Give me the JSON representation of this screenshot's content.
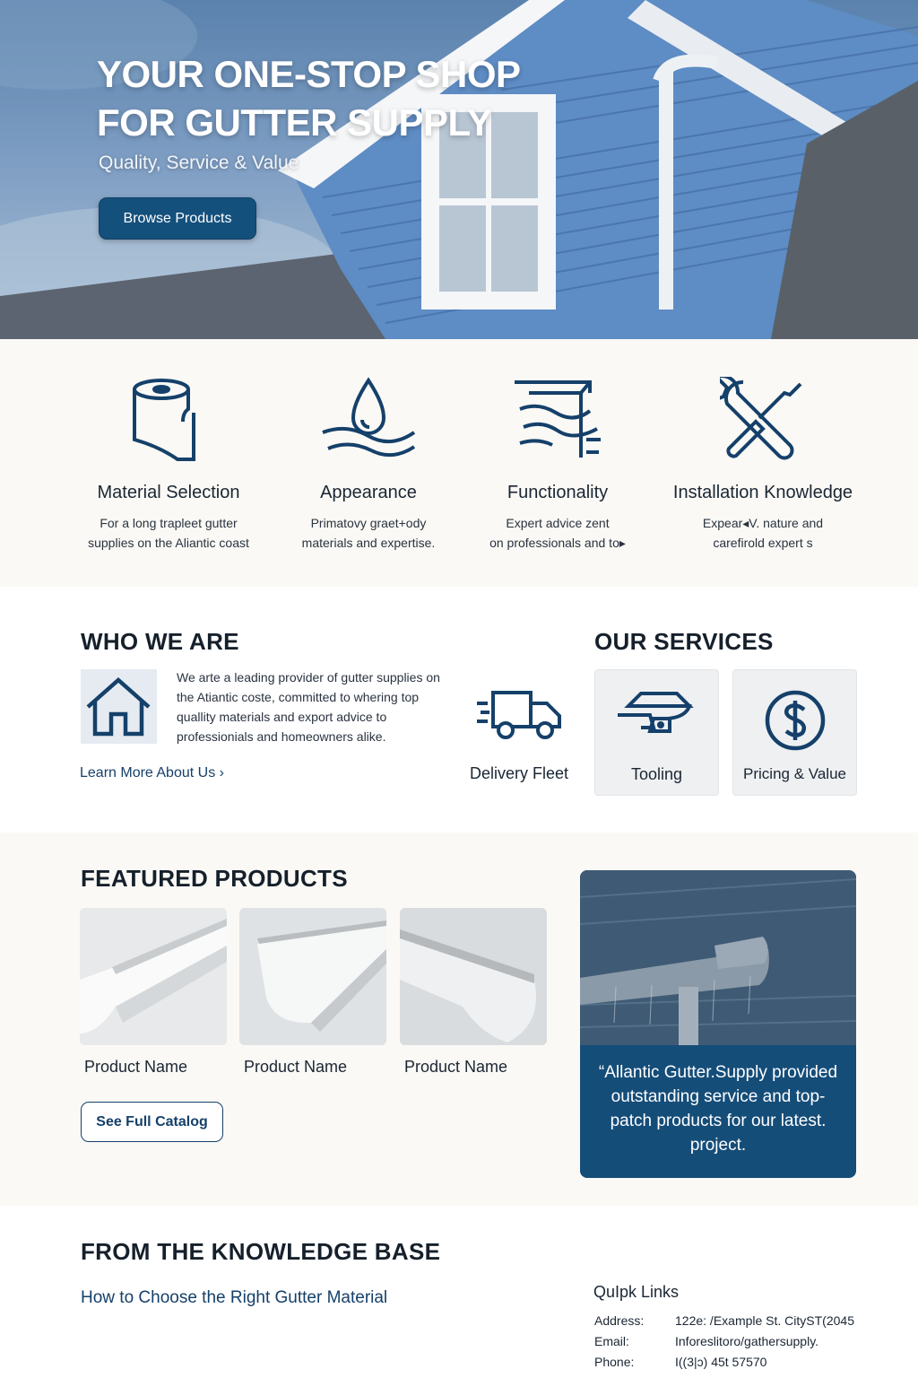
{
  "hero": {
    "title": "YOUR ONE-STOP SHOP\nFOR GUTTER SUPPLY",
    "subtitle": "Quality, Service & Value",
    "button_label": "Browse Products"
  },
  "features": [
    {
      "icon": "paper-roll-icon",
      "title": "Material Selection",
      "desc": "For a long trapleet gutter\nsupplies on the Aliantic coast"
    },
    {
      "icon": "water-drop-icon",
      "title": "Appearance",
      "desc": "Primatovy graet+ody\nmaterials and expertise."
    },
    {
      "icon": "gutter-flow-icon",
      "title": "Functionality",
      "desc": "Expert advice zent\non professionals and to▸"
    },
    {
      "icon": "wrench-screwdriver-icon",
      "title": "Installation Knowledge",
      "desc": "Expear◂V. nature and\ncarefirold expert s"
    }
  ],
  "who": {
    "title": "WHO WE ARE",
    "text": "We arte a leading provider of gutter supplies on the Atiantic coste, committed to whering top quallity materials and export advice to professionials and homeowners alike.",
    "link": "Learn More About Us ›"
  },
  "services": {
    "title": "OUR SERVICES",
    "items": [
      {
        "icon": "delivery-truck-icon",
        "label": "Delivery Fleet"
      },
      {
        "icon": "tooling-icon",
        "label": "Tooling"
      },
      {
        "icon": "dollar-icon",
        "label": "Pricing & Value"
      }
    ]
  },
  "products": {
    "title": "FEATURED PRODUCTS",
    "items": [
      {
        "name": "Product Name"
      },
      {
        "name": "Product Name"
      },
      {
        "name": "Product Name"
      }
    ],
    "catalog_button": "See Full Catalog"
  },
  "testimonial": {
    "quote": "“Allantic Gutter.Supply provided outstanding service and top-patch products for our latest. project."
  },
  "knowledge": {
    "title": "FROM THE KNOWLEDGE BASE",
    "article": "How to Choose the Right Gutter Material"
  },
  "quick_links": {
    "title": "QuIpk Links",
    "address_label": "Address:",
    "address": "122e: /Example St. CityST(2045",
    "email_label": "Email:",
    "email": "Inforeslitoro/gathersupply.",
    "phone_label": "Phone:",
    "phone": "I((3|ɔ) 45t 57570"
  },
  "colors": {
    "brand_navy": "#14507c",
    "cream": "#faf9f5",
    "icon_stroke": "#15406a"
  }
}
